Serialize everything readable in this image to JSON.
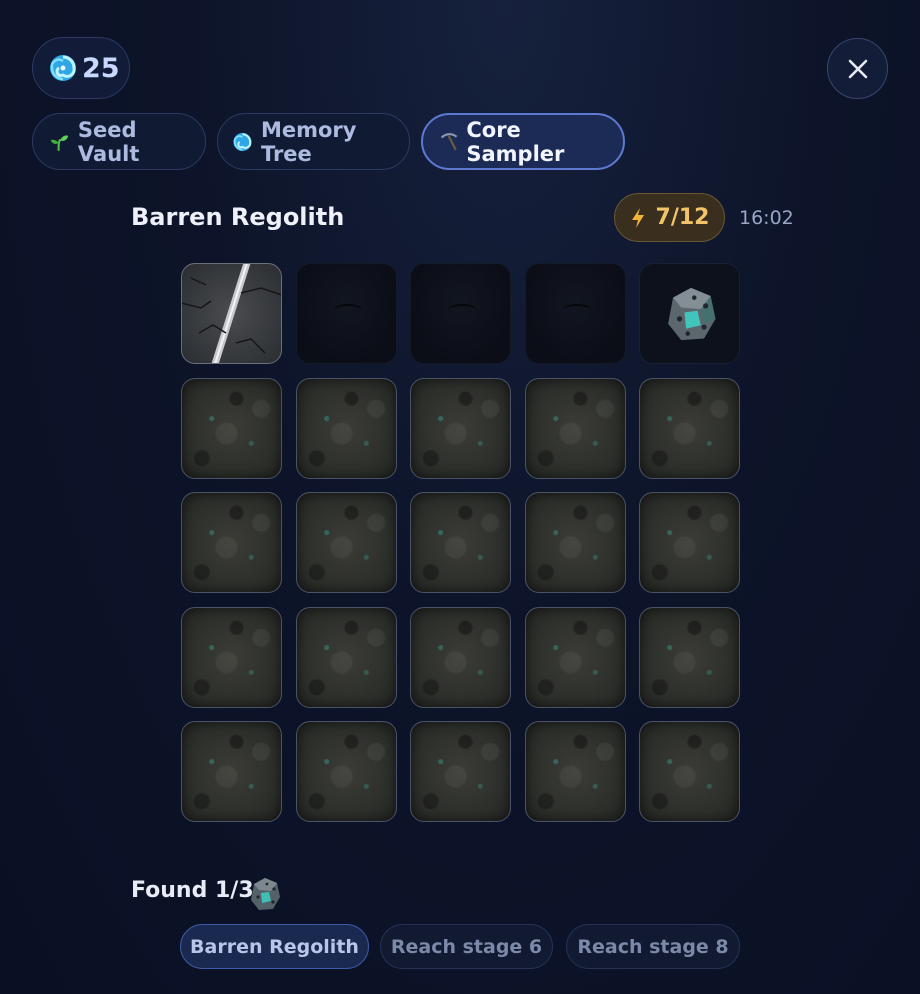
{
  "currency": {
    "value": "25",
    "icon": "swirl-icon"
  },
  "tabs": [
    {
      "label": "Seed Vault",
      "icon": "sprout-icon",
      "active": false
    },
    {
      "label": "Memory Tree",
      "icon": "swirl-icon",
      "active": false
    },
    {
      "label": "Core Sampler",
      "icon": "pickaxe-icon",
      "active": true
    }
  ],
  "board": {
    "title": "Barren Regolith",
    "energy": "7/12",
    "energy_icon": "lightning-icon",
    "timer": "16:02",
    "rows": [
      [
        "cracked",
        "dug",
        "dug",
        "dug",
        "ore"
      ],
      [
        "soil",
        "soil",
        "soil",
        "soil",
        "soil"
      ],
      [
        "soil",
        "soil",
        "soil",
        "soil",
        "soil"
      ],
      [
        "soil",
        "soil",
        "soil",
        "soil",
        "soil"
      ],
      [
        "soil",
        "soil",
        "soil",
        "soil",
        "soil"
      ]
    ]
  },
  "progress": {
    "found_label": "Found 1/3",
    "icon": "ore-icon"
  },
  "stages": [
    {
      "label": "Barren Regolith",
      "active": true
    },
    {
      "label": "Reach stage 6",
      "active": false
    },
    {
      "label": "Reach stage 8",
      "active": false
    }
  ],
  "colors": {
    "accent": "#5d7ad0",
    "energy": "#f2c46a",
    "ore": "#3ecfc2"
  }
}
